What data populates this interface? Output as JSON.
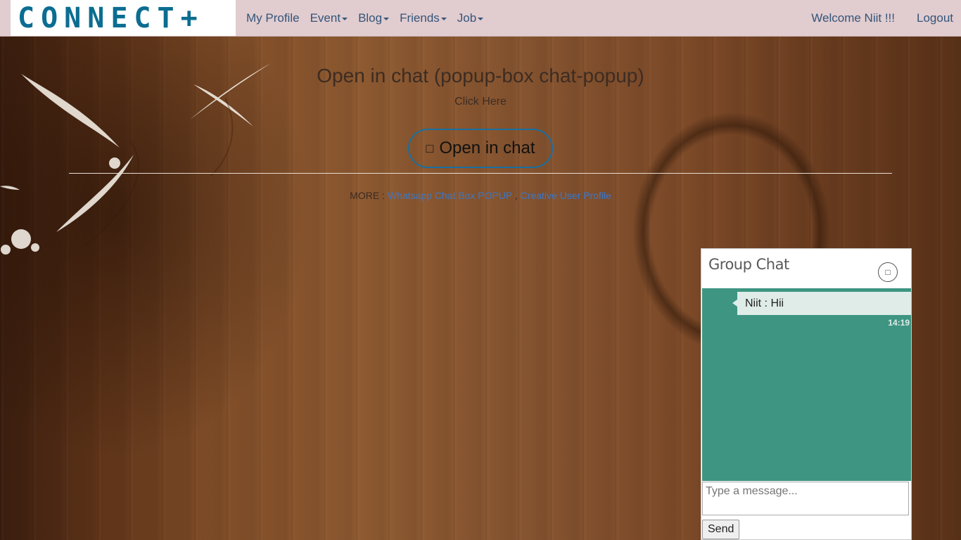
{
  "brand": {
    "logo_text": "CONNECT+"
  },
  "nav": {
    "items": [
      {
        "label": "My Profile",
        "dropdown": false
      },
      {
        "label": "Event",
        "dropdown": true
      },
      {
        "label": "Blog",
        "dropdown": true
      },
      {
        "label": "Friends",
        "dropdown": true
      },
      {
        "label": "Job",
        "dropdown": true
      }
    ],
    "welcome": "Welcome Niit !!!",
    "logout": "Logout"
  },
  "hero": {
    "title": "Open in chat (popup-box chat-popup)",
    "subtitle": "Click Here",
    "button_icon": "comment-icon",
    "button_label": "Open in chat"
  },
  "more": {
    "prefix": "MORE : ",
    "links": [
      "Whatsapp Chat Box POPUP",
      "Creative User Profile"
    ],
    "separator": " , "
  },
  "chat": {
    "title": "Group Chat",
    "close_icon": "close-icon",
    "messages": [
      {
        "text": "Niit : Hii",
        "time": "14:19"
      }
    ],
    "input_placeholder": "Type a message...",
    "send_label": "Send",
    "body_color": "#3e9582"
  },
  "colors": {
    "brand": "#0b6d91",
    "navbar_bg": "#e1cccf",
    "nav_text": "#33557a",
    "link": "#3a78c8",
    "button_border": "#1a6fa0"
  }
}
